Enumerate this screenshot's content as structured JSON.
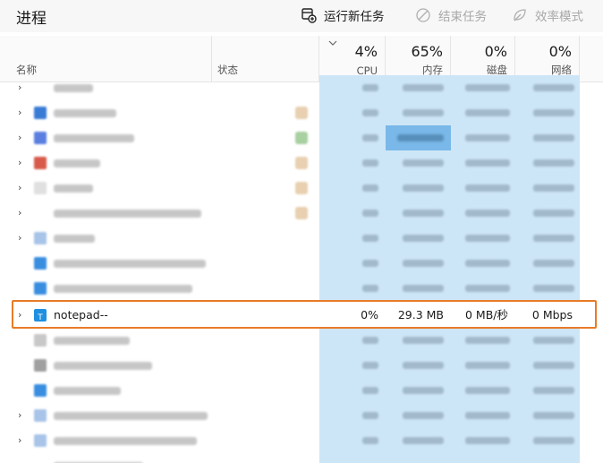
{
  "page_title": "进程",
  "toolbar": {
    "new_task_label": "运行新任务",
    "end_task_label": "结束任务",
    "efficiency_label": "效率模式"
  },
  "columns": {
    "name": "名称",
    "status": "状态",
    "cpu": {
      "label": "CPU",
      "percent": "4%"
    },
    "memory": {
      "label": "内存",
      "percent": "65%"
    },
    "disk": {
      "label": "磁盘",
      "percent": "0%"
    },
    "network": {
      "label": "网络",
      "percent": "0%"
    }
  },
  "selected_process": {
    "name": "notepad--",
    "cpu": "0%",
    "memory": "29.3 MB",
    "disk": "0 MB/秒",
    "network": "0 Mbps"
  },
  "colors": {
    "accent_highlight": "#e87b27",
    "column_shade": "#cde6f7",
    "strong_shade": "#79b8e8"
  }
}
